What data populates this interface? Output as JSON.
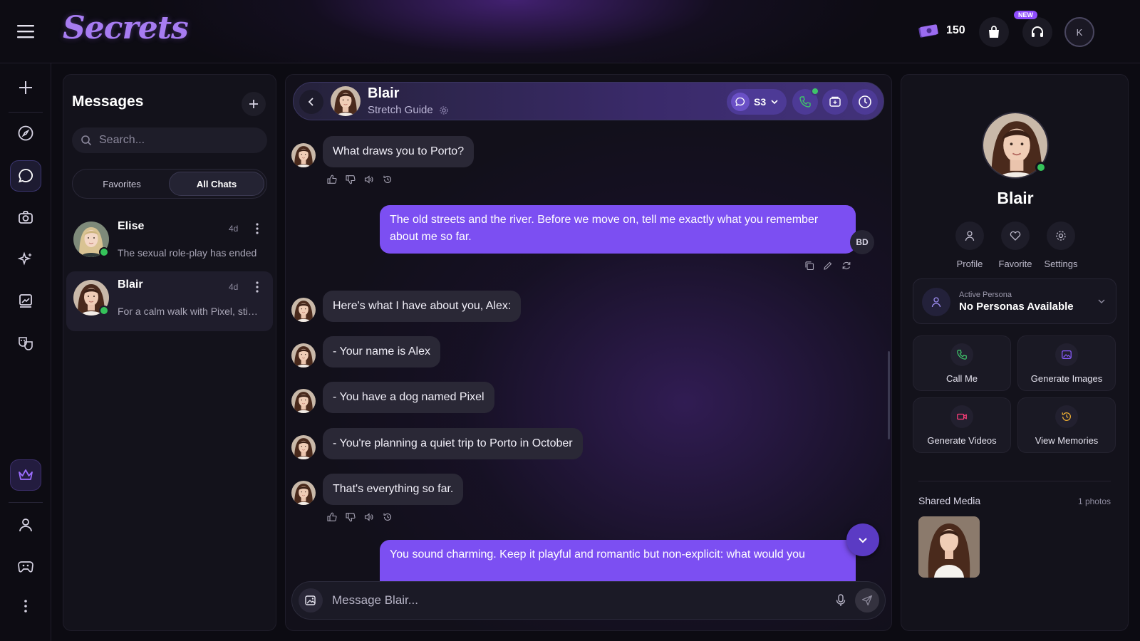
{
  "app": {
    "logo": "Secrets"
  },
  "topbar": {
    "coins": "150",
    "new_badge": "NEW",
    "user_initial": "K",
    "icons": [
      "hamburger-icon",
      "coins-icon",
      "shopping-bag-icon",
      "headset-icon"
    ]
  },
  "rail": {
    "icons": [
      "plus-icon",
      "compass-icon",
      "chat-bubble-icon",
      "camera-icon",
      "sparkles-icon",
      "gallery-stack-icon",
      "masks-icon",
      "crown-icon",
      "user-icon",
      "gamepad-icon",
      "more-vertical-icon"
    ],
    "active": "chat-bubble-icon"
  },
  "messages": {
    "title": "Messages",
    "search_placeholder": "Search...",
    "tabs": [
      {
        "label": "Favorites",
        "active": false
      },
      {
        "label": "All Chats",
        "active": true
      }
    ],
    "chats": [
      {
        "name": "Elise",
        "time": "4d",
        "preview": "The sexual role-play has ended",
        "online": true,
        "selected": false
      },
      {
        "name": "Blair",
        "time": "4d",
        "preview": "For a calm walk with Pixel, stick to the river",
        "online": true,
        "selected": true
      }
    ]
  },
  "chat": {
    "name": "Blair",
    "subtitle": "Stretch Guide",
    "model_label": "S3",
    "messages": [
      {
        "role": "bot",
        "text": "What draws you to Porto?"
      },
      {
        "role": "user",
        "text": "The old streets and the river. Before we move on, tell me exactly what you remember about me so far."
      },
      {
        "role": "bot",
        "text": "Here's what I have about you, Alex:"
      },
      {
        "role": "bot",
        "text": "- Your name is Alex"
      },
      {
        "role": "bot",
        "text": "- You have a dog named Pixel"
      },
      {
        "role": "bot",
        "text": "- You're planning a quiet trip to Porto in October"
      },
      {
        "role": "bot",
        "text": "That's everything so far."
      },
      {
        "role": "user",
        "text": "You sound charming. Keep it playful and romantic but non-explicit: what would you"
      }
    ],
    "user_initials": "BD",
    "composer_placeholder": "Message Blair..."
  },
  "profile": {
    "name": "Blair",
    "online": true,
    "quick_actions": [
      {
        "label": "Profile",
        "icon": "user-icon"
      },
      {
        "label": "Favorite",
        "icon": "heart-icon"
      },
      {
        "label": "Settings",
        "icon": "gear-icon"
      }
    ],
    "persona": {
      "label": "Active Persona",
      "value": "No Personas Available"
    },
    "features": [
      {
        "label": "Call Me",
        "icon": "phone-icon",
        "color": "#3fc46a"
      },
      {
        "label": "Generate Images",
        "icon": "image-icon",
        "color": "#8a5cff"
      },
      {
        "label": "Generate Videos",
        "icon": "video-icon",
        "color": "#ff3e7a"
      },
      {
        "label": "View Memories",
        "icon": "memory-icon",
        "color": "#f2b233"
      }
    ],
    "shared_media": {
      "title": "Shared Media",
      "count": "1 photos"
    }
  },
  "colors": {
    "accent": "#7c4ff2",
    "online": "#35c35a",
    "background": "#0c0b12",
    "bot_bubble": "#2a2836"
  }
}
